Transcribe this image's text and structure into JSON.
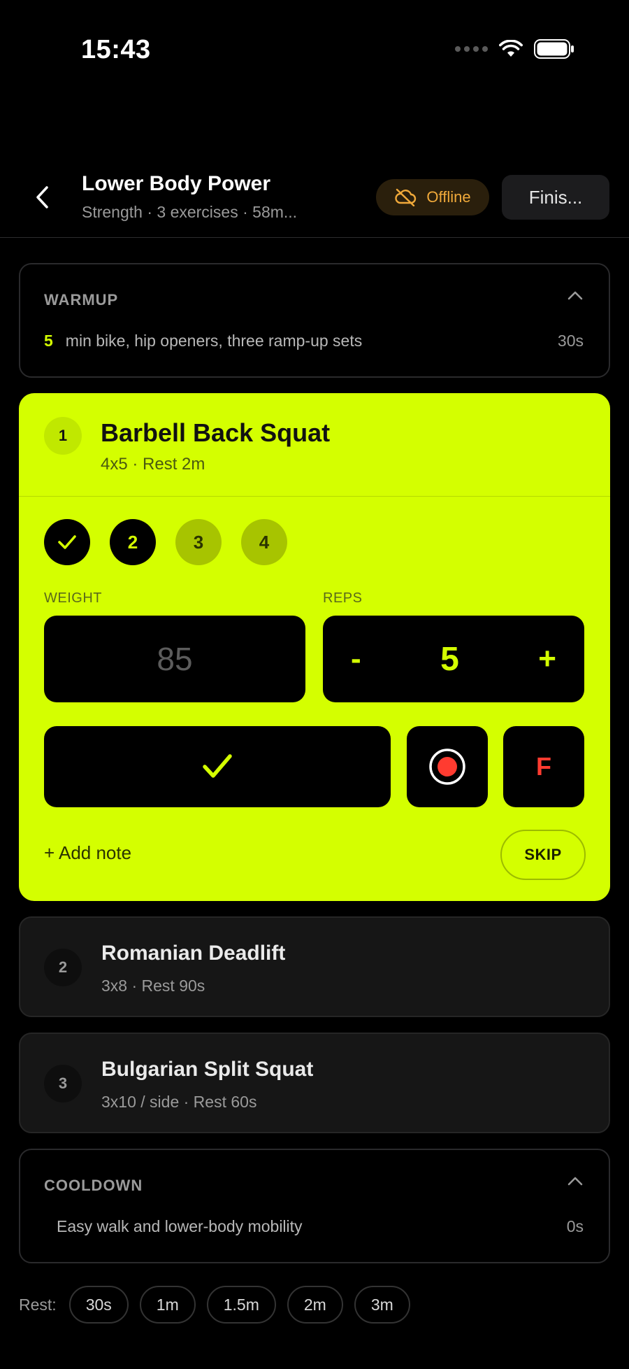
{
  "status_bar": {
    "time": "15:43"
  },
  "header": {
    "title": "Lower Body Power",
    "subtitle": "Strength · 3 exercises · 58m...",
    "offline_label": "Offline",
    "finish_label": "Finis..."
  },
  "warmup": {
    "heading": "WARMUP",
    "number": "5",
    "text": "min bike, hip openers, three ramp-up sets",
    "duration": "30s"
  },
  "active_exercise": {
    "index": "1",
    "title": "Barbell Back Squat",
    "subtitle": "4x5 · Rest 2m",
    "sets": [
      {
        "label": "",
        "state": "done"
      },
      {
        "label": "2",
        "state": "current"
      },
      {
        "label": "3",
        "state": "pending"
      },
      {
        "label": "4",
        "state": "pending"
      }
    ],
    "weight_label": "WEIGHT",
    "weight_placeholder": "85",
    "reps_label": "REPS",
    "reps_minus": "-",
    "reps_value": "5",
    "reps_plus": "+",
    "fail_label": "F",
    "add_note": "+ Add note",
    "skip_label": "SKIP"
  },
  "exercises": [
    {
      "index": "2",
      "title": "Romanian Deadlift",
      "subtitle": "3x8 · Rest 90s"
    },
    {
      "index": "3",
      "title": "Bulgarian Split Squat",
      "subtitle": "3x10 / side · Rest 60s"
    }
  ],
  "cooldown": {
    "heading": "COOLDOWN",
    "text": "Easy walk and lower-body mobility",
    "duration": "0s"
  },
  "rest": {
    "label": "Rest:",
    "options": [
      "30s",
      "1m",
      "1.5m",
      "2m",
      "3m"
    ]
  },
  "colors": {
    "accent": "#d4ff00",
    "background": "#000000",
    "card": "#161616",
    "offline": "#f0a93a",
    "fail": "#ff3b30"
  }
}
